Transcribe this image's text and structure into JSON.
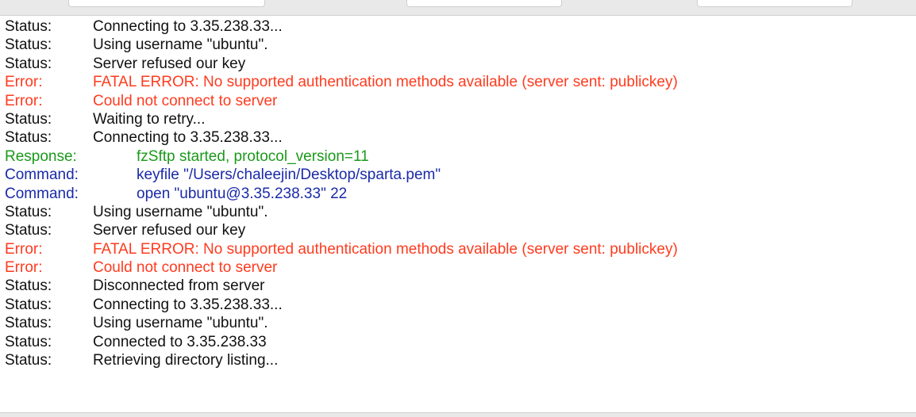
{
  "colors": {
    "status": "#111111",
    "error": "#ff3b1f",
    "response": "#1a9a1a",
    "command": "#1a2aa8"
  },
  "log": [
    {
      "type": "Status:",
      "kind": "status",
      "msg": "Connecting to 3.35.238.33..."
    },
    {
      "type": "Status:",
      "kind": "status",
      "msg": "Using username \"ubuntu\"."
    },
    {
      "type": "Status:",
      "kind": "status",
      "msg": "Server refused our key"
    },
    {
      "type": "Error:",
      "kind": "error",
      "msg": "FATAL ERROR: No supported authentication methods available (server sent: publickey)"
    },
    {
      "type": "Error:",
      "kind": "error",
      "msg": "Could not connect to server"
    },
    {
      "type": "Status:",
      "kind": "status",
      "msg": "Waiting to retry..."
    },
    {
      "type": "Status:",
      "kind": "status",
      "msg": "Connecting to 3.35.238.33..."
    },
    {
      "type": "Response:",
      "kind": "response",
      "msg": "fzSftp started, protocol_version=11"
    },
    {
      "type": "Command:",
      "kind": "command",
      "msg": "keyfile \"/Users/chaleejin/Desktop/sparta.pem\""
    },
    {
      "type": "Command:",
      "kind": "command",
      "msg": "open \"ubuntu@3.35.238.33\" 22"
    },
    {
      "type": "Status:",
      "kind": "status",
      "msg": "Using username \"ubuntu\"."
    },
    {
      "type": "Status:",
      "kind": "status",
      "msg": "Server refused our key"
    },
    {
      "type": "Error:",
      "kind": "error",
      "msg": "FATAL ERROR: No supported authentication methods available (server sent: publickey)"
    },
    {
      "type": "Error:",
      "kind": "error",
      "msg": "Could not connect to server"
    },
    {
      "type": "Status:",
      "kind": "status",
      "msg": "Disconnected from server"
    },
    {
      "type": "Status:",
      "kind": "status",
      "msg": "Connecting to 3.35.238.33..."
    },
    {
      "type": "Status:",
      "kind": "status",
      "msg": "Using username \"ubuntu\"."
    },
    {
      "type": "Status:",
      "kind": "status",
      "msg": "Connected to 3.35.238.33"
    },
    {
      "type": "Status:",
      "kind": "status",
      "msg": "Retrieving directory listing..."
    }
  ]
}
